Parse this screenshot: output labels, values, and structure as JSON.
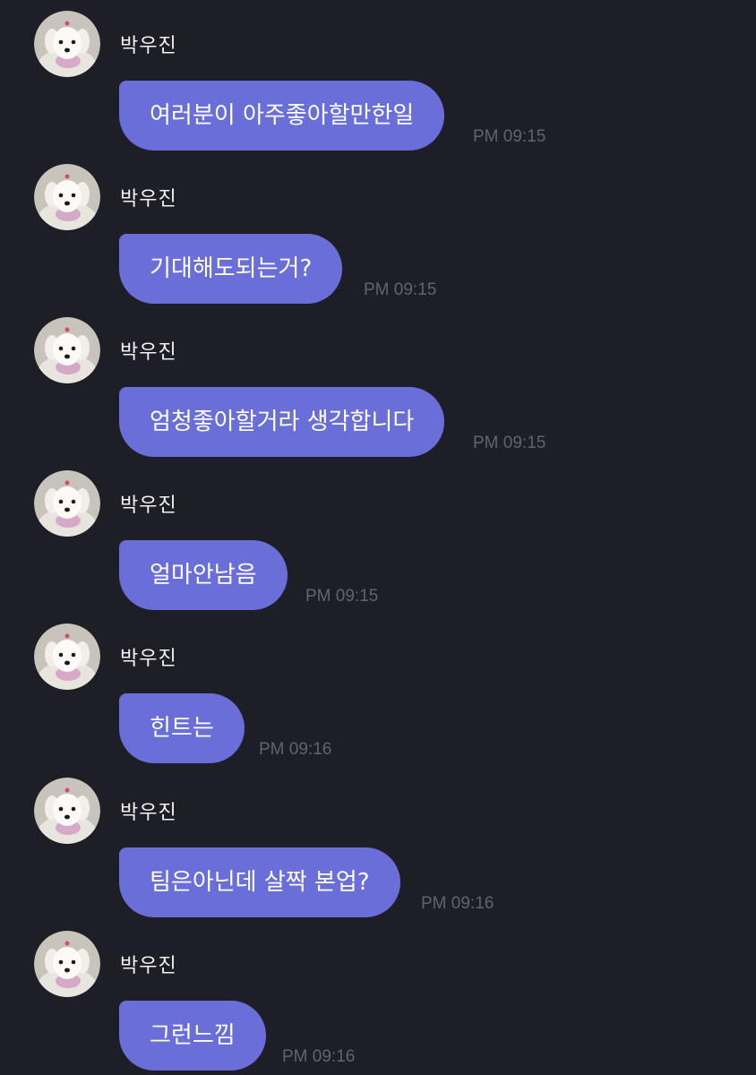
{
  "messages": [
    {
      "sender": "박우진",
      "text": "여러분이 아주좋아할만한일",
      "time": "PM 09:15"
    },
    {
      "sender": "박우진",
      "text": "기대해도되는거?",
      "time": "PM 09:15"
    },
    {
      "sender": "박우진",
      "text": "엄청좋아할거라 생각합니다",
      "time": "PM 09:15"
    },
    {
      "sender": "박우진",
      "text": "얼마안남음",
      "time": "PM 09:15"
    },
    {
      "sender": "박우진",
      "text": "힌트는",
      "time": "PM 09:16"
    },
    {
      "sender": "박우진",
      "text": "팀은아닌데 살짝 본업?",
      "time": "PM 09:16"
    },
    {
      "sender": "박우진",
      "text": "그런느낌",
      "time": "PM 09:16"
    }
  ],
  "colors": {
    "background": "#1e1e26",
    "bubble": "#6a6ed9",
    "bubble_text": "#ffffff",
    "sender_text": "#f2f2f4",
    "timestamp": "#62636d"
  },
  "icons": {
    "avatar": "white-puppy-avatar-icon"
  }
}
